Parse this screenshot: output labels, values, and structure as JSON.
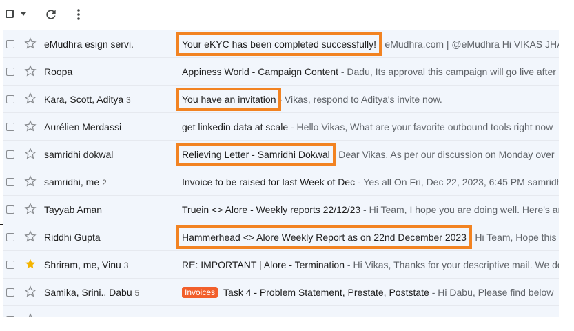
{
  "toolbar": {
    "select_all_icon": "checkbox-icon",
    "select_menu_icon": "caret-down-icon",
    "refresh_icon": "refresh-icon",
    "more_icon": "more-vert-icon"
  },
  "colors": {
    "highlight": "#f28322",
    "label_invoices": "#f25f2b",
    "star_filled": "#f4b400",
    "row_bg": "#f2f6fc"
  },
  "emails": [
    {
      "sender": "eMudhra esign servi.",
      "count": "",
      "starred": false,
      "label": "",
      "subject": "Your eKYC has been completed successfully!",
      "snippet": " - eMudhra.com | @eMudhra Hi VIKAS JHA"
    },
    {
      "sender": "Roopa",
      "count": "",
      "starred": false,
      "label": "",
      "subject": "Appiness World - Campaign Content",
      "snippet": " - Dadu, Its approval this campaign will go live after"
    },
    {
      "sender": "Kara, Scott, Aditya",
      "count": "3",
      "starred": false,
      "label": "",
      "subject": "You have an invitation",
      "snippet": " - Vikas, respond to Aditya's invite now."
    },
    {
      "sender": "Aurélien Merdassi",
      "count": "",
      "starred": false,
      "label": "",
      "subject": "get linkedin data at scale",
      "snippet": " - Hello Vikas, What are your favorite outbound tools right now"
    },
    {
      "sender": "samridhi dokwal",
      "count": "",
      "starred": false,
      "label": "",
      "subject": "Relieving Letter - Samridhi Dokwal",
      "snippet": " - Dear Vikas, As per our discussion on Monday over"
    },
    {
      "sender": "samridhi, me",
      "count": "2",
      "starred": false,
      "label": "",
      "subject": "Invoice to be raised for last Week of Dec",
      "snippet": " - Yes all On Fri, Dec 22, 2023, 6:45 PM samridhi"
    },
    {
      "sender": "Tayyab Aman",
      "count": "",
      "starred": false,
      "label": "",
      "subject": "Truein <> Alore - Weekly reports 22/12/23",
      "snippet": " - Hi Team, I hope you are doing well. Here's an"
    },
    {
      "sender": "Riddhi Gupta",
      "count": "",
      "starred": false,
      "label": "",
      "subject": "Hammerhead <> Alore Weekly Report as on 22nd December 2023",
      "snippet": " - Hi Team, Hope this"
    },
    {
      "sender": "Shriram, me, Vinu",
      "count": "3",
      "starred": true,
      "label": "",
      "subject": "RE: IMPORTANT | Alore - Termination",
      "snippet": " - Hi Vikas, Thanks for your descriptive mail. We do"
    },
    {
      "sender": "Samika, Srini., Dabu",
      "count": "5",
      "starred": false,
      "label": "Invoices",
      "subject": "Task 4 - Problem Statement, Prestate, Poststate",
      "snippet": " - Hi Dabu, Please find below"
    },
    {
      "sender": "Anuprasni",
      "count": "",
      "starred": false,
      "label": "",
      "subject": "Your Amazon Fresh order is out for delivery",
      "snippet": " - Amazon Fresh Out for Delivery Hello Vikas"
    }
  ]
}
